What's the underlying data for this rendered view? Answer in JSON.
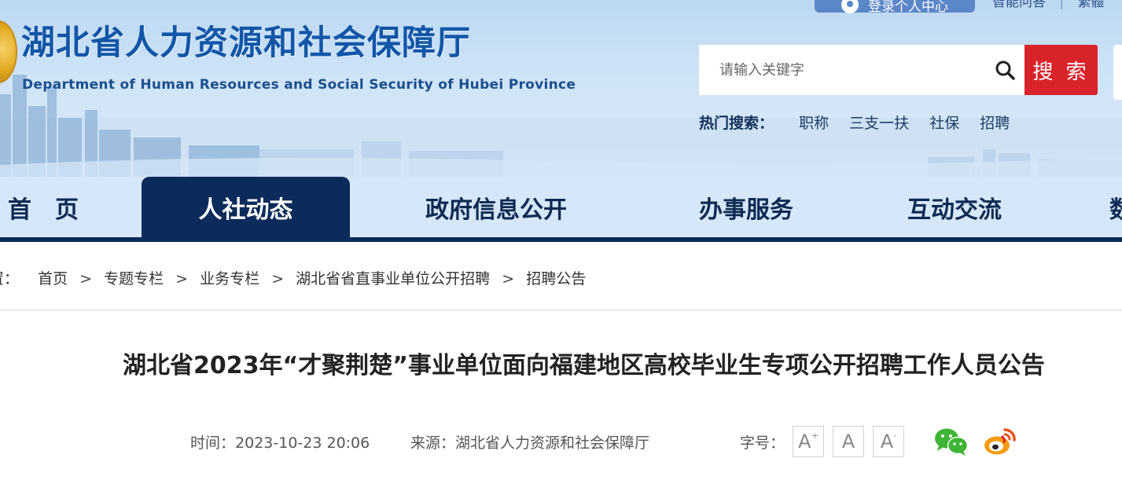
{
  "header": {
    "site_title": "湖北省人力资源和社会保障厅",
    "site_subtitle": "Department of Human Resources and Social Security of Hubei Province",
    "login_label": "登录个人中心",
    "top_links": [
      "智能问答",
      "繁體"
    ],
    "search": {
      "placeholder": "请输入关键字",
      "button_label": "搜 索"
    },
    "hot_search": {
      "label": "热门搜索：",
      "items": [
        "职称",
        "三支一扶",
        "社保",
        "招聘"
      ]
    },
    "colors": {
      "title": "#1356a8",
      "search_button": "#d9232b",
      "nav_active": "#0b2b5a"
    }
  },
  "nav": {
    "items": [
      "首　页",
      "人社动态",
      "政府信息公开",
      "办事服务",
      "互动交流",
      "数"
    ],
    "active_index": 1
  },
  "breadcrumb": {
    "prefix": "置：",
    "items": [
      "首页",
      "专题专栏",
      "业务专栏",
      "湖北省省直事业单位公开招聘",
      "招聘公告"
    ],
    "separator": ">"
  },
  "article": {
    "title": "湖北省2023年“才聚荆楚”事业单位面向福建地区高校毕业生专项公开招聘工作人员公告",
    "time_label": "时间：",
    "time_value": "2023-10-23 20:06",
    "source_label": "来源：",
    "source_value": "湖北省人力资源和社会保障厅",
    "font_size_label": "字号：",
    "font_buttons": {
      "increase": "A",
      "increase_mark": "+",
      "normal": "A",
      "decrease": "A",
      "decrease_mark": "-"
    },
    "share_icons": [
      "wechat-icon",
      "weibo-icon"
    ]
  }
}
